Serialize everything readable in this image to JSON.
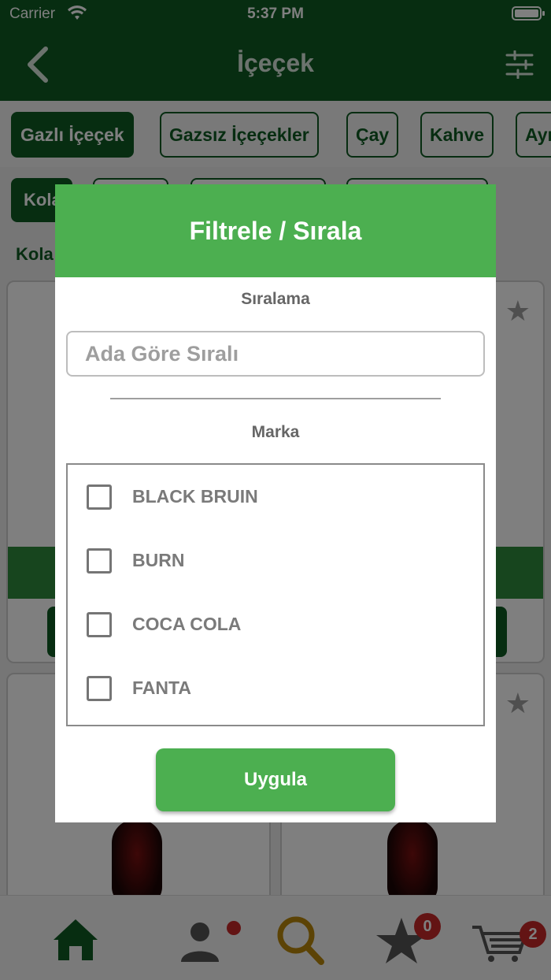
{
  "status_bar": {
    "carrier": "Carrier",
    "time": "5:37 PM"
  },
  "header": {
    "title": "İçeçek"
  },
  "categories": [
    {
      "label": "Gazlı İçeçek",
      "active": true
    },
    {
      "label": "Gazsız İçeçekler",
      "active": false
    },
    {
      "label": "Çay",
      "active": false
    },
    {
      "label": "Kahve",
      "active": false
    },
    {
      "label": "Ayı",
      "active": false
    }
  ],
  "subcategory": {
    "active_label": "Kola"
  },
  "section_label": "Kola",
  "tabbar": {
    "favorites_count": "0",
    "cart_count": "2"
  },
  "modal": {
    "title": "Filtrele / Sırala",
    "sort_label": "Sıralama",
    "sort_value": "Ada Göre Sıralı",
    "brand_label": "Marka",
    "brands": [
      {
        "name": "BLACK BRUIN",
        "checked": false
      },
      {
        "name": "BURN",
        "checked": false
      },
      {
        "name": "COCA COLA",
        "checked": false
      },
      {
        "name": "FANTA",
        "checked": false
      }
    ],
    "apply_label": "Uygula"
  },
  "colors": {
    "primary": "#0e5a23",
    "accent": "#4caf50",
    "badge": "#c62828"
  }
}
